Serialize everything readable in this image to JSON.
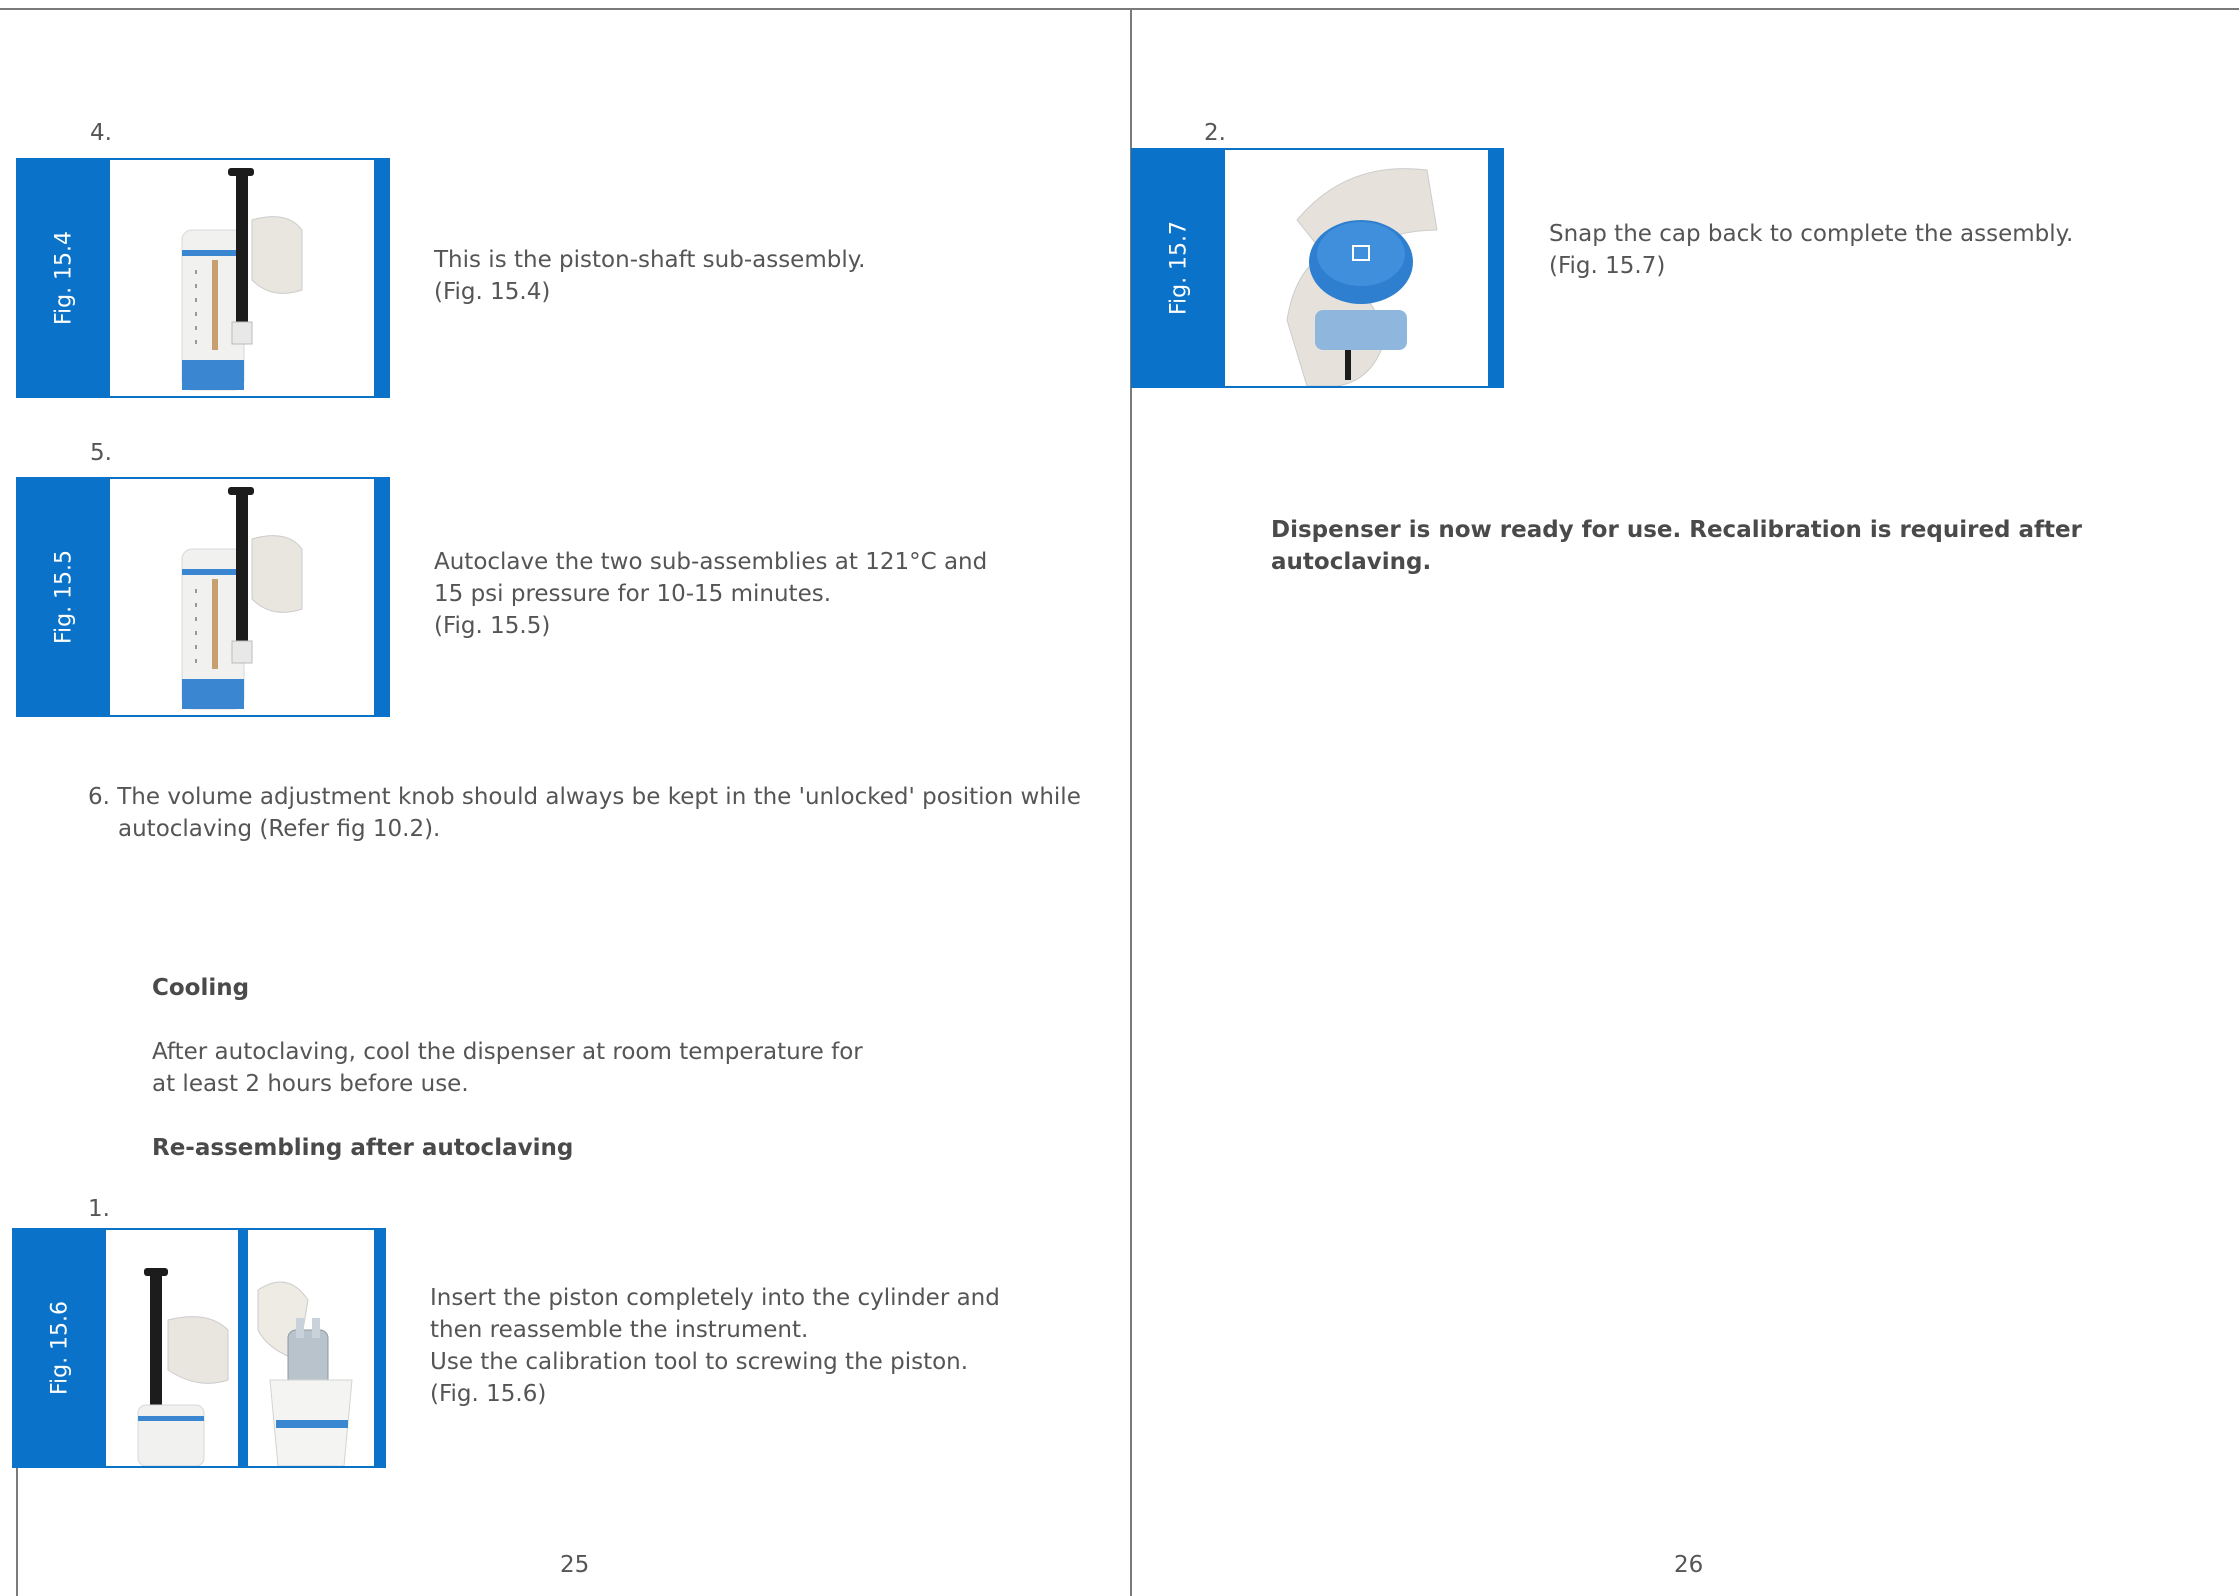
{
  "left_page": {
    "step4": {
      "number": "4.",
      "fig_label": "Fig. 15.4",
      "line1": "This is the piston-shaft sub-assembly.",
      "line2": "(Fig. 15.4)"
    },
    "step5": {
      "number": "5.",
      "fig_label": "Fig. 15.5",
      "line1": "Autoclave the two sub-assemblies at 121°C and",
      "line2": "15 psi pressure for 10-15 minutes.",
      "line3": "(Fig. 15.5)"
    },
    "step6": {
      "line1": "6. The volume adjustment knob should always be kept in the 'unlocked' position while",
      "line2": "autoclaving (Refer fig 10.2)."
    },
    "cooling": {
      "heading": "Cooling",
      "line1": "After autoclaving, cool the dispenser at room temperature for",
      "line2": "at least 2 hours before use."
    },
    "reassembling": {
      "heading": "Re-assembling after autoclaving",
      "number": "1.",
      "fig_label": "Fig. 15.6",
      "line1": "Insert the piston completely into the cylinder and",
      "line2": "then reassemble the instrument.",
      "line3": "Use the calibration tool to screwing the piston.",
      "line4": "(Fig. 15.6)"
    },
    "page_number": "25"
  },
  "right_page": {
    "step2": {
      "number": "2.",
      "fig_label": "Fig. 15.7",
      "line1": "Snap the cap back to complete the assembly.",
      "line2": "(Fig. 15.7)"
    },
    "notice": "Dispenser is now ready for use. Recalibration is required after autoclaving.",
    "page_number": "26"
  },
  "colors": {
    "accent_blue": "#0a72c9",
    "text_gray": "#555555",
    "rule_gray": "#7a7a7a"
  }
}
